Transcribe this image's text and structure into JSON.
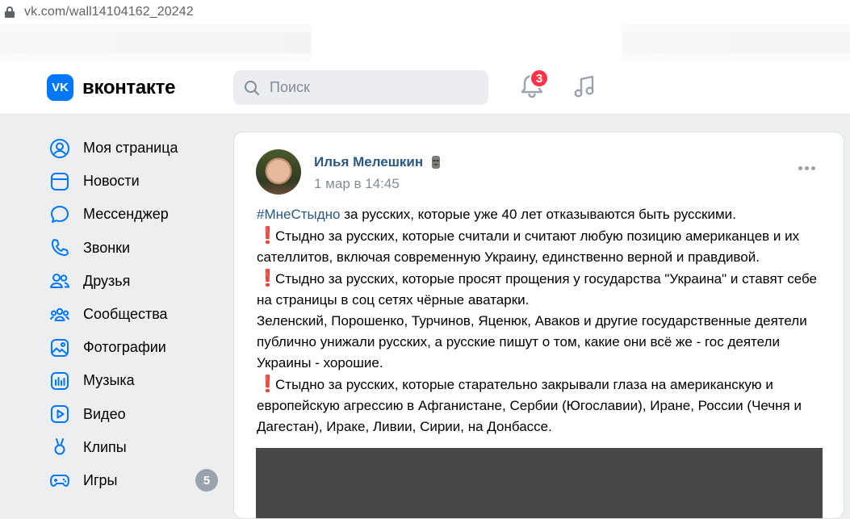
{
  "browser": {
    "url": "vk.com/wall14104162_20242"
  },
  "header": {
    "logo_text": "вконтакте",
    "logo_mark": "VK",
    "search_placeholder": "Поиск",
    "notifications_count": "3",
    "accent": "#0077ff"
  },
  "sidebar": {
    "items": [
      {
        "label": "Моя страница",
        "icon": "user-circle-icon"
      },
      {
        "label": "Новости",
        "icon": "news-icon"
      },
      {
        "label": "Мессенджер",
        "icon": "chat-bubble-icon"
      },
      {
        "label": "Звонки",
        "icon": "phone-icon"
      },
      {
        "label": "Друзья",
        "icon": "friends-icon"
      },
      {
        "label": "Сообщества",
        "icon": "communities-icon"
      },
      {
        "label": "Фотографии",
        "icon": "photo-icon"
      },
      {
        "label": "Музыка",
        "icon": "music-chart-icon"
      },
      {
        "label": "Видео",
        "icon": "video-icon"
      },
      {
        "label": "Клипы",
        "icon": "clips-icon"
      },
      {
        "label": "Игры",
        "icon": "gamepad-icon",
        "count": "5"
      }
    ]
  },
  "post": {
    "author": "Илья Мелешкин",
    "date": "1 мар в 14:45",
    "hashtag": "#МнеСтыдно",
    "line1": " за русских, которые уже 40 лет отказываются быть русскими.",
    "p2": "Стыдно за русских, которые считали и считают любую позицию американцев и их сателлитов, включая современную Украину, единственно верной и правдивой.",
    "p3": "Стыдно за русских, которые просят прощения у государства \"Украина\" и ставят себе на страницы в соц сетях чёрные аватарки.",
    "p4": "Зеленский, Порошенко, Турчинов, Яценюк, Аваков и другие государственные деятели публично унижали русских, а русские пишут о том, какие они всё же - гос деятели Украины - хорошие.",
    "p5": "Стыдно за русских, которые старательно закрывали глаза на американскую и европейскую агрессию в Афганистане, Сербии (Югославии), Иране, России (Чечня и Дагестан), Ираке, Ливии, Сирии, на Донбассе.",
    "excl": "❗"
  }
}
